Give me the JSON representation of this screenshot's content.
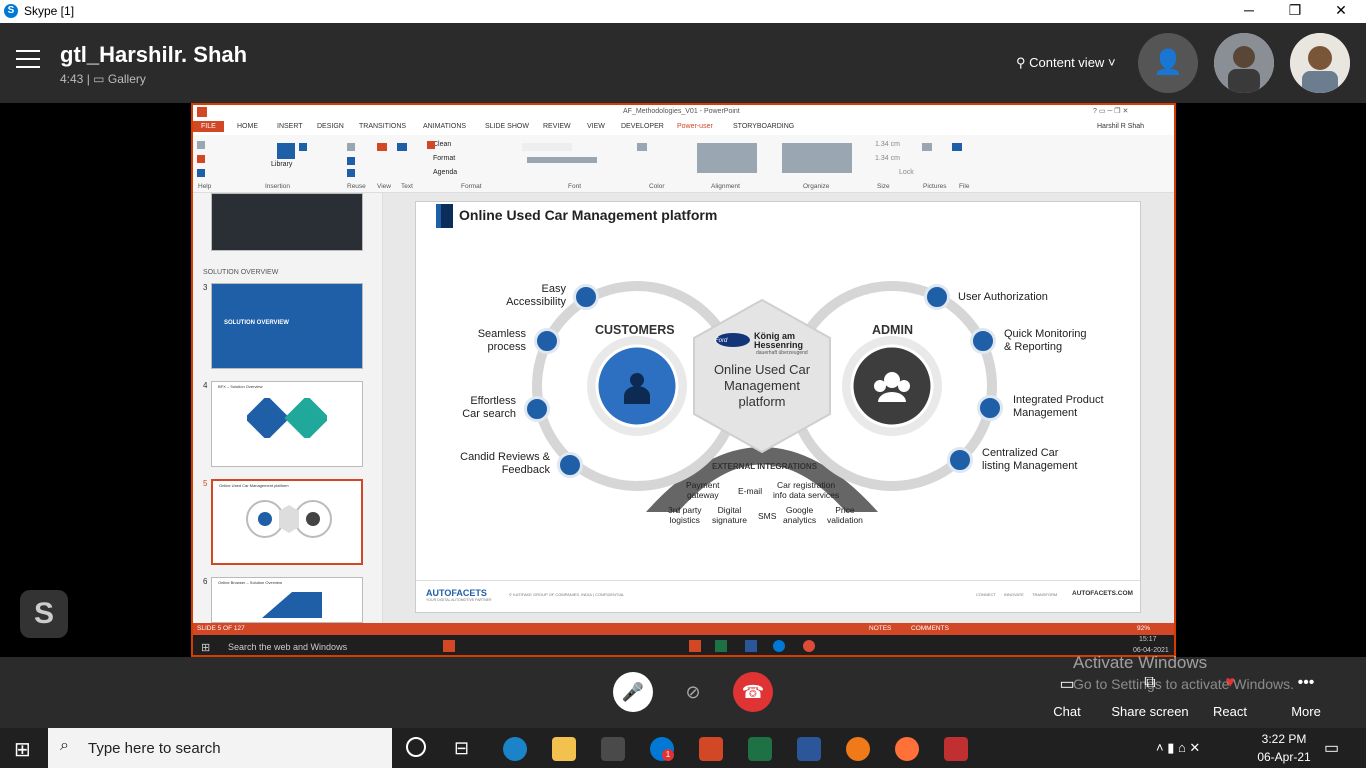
{
  "window": {
    "title": "Skype [1]"
  },
  "call": {
    "name": "gtl_Harshilr. Shah",
    "duration": "4:43",
    "separator": "|",
    "layout": "Gallery",
    "content_view": "Content view"
  },
  "ppt": {
    "doc_title": "AF_Methodologies_V01 - PowerPoint",
    "user": "Harshil R Shah",
    "tabs": [
      "FILE",
      "HOME",
      "INSERT",
      "DESIGN",
      "TRANSITIONS",
      "ANIMATIONS",
      "SLIDE SHOW",
      "REVIEW",
      "VIEW",
      "DEVELOPER",
      "Power-user",
      "STORYBOARDING"
    ],
    "ribbon_groups": [
      "Help",
      "Insertion",
      "Reuse",
      "View",
      "Text",
      "Format",
      "Font",
      "Color",
      "Alignment",
      "Organize",
      "Size",
      "Pictures",
      "File"
    ],
    "ribbon_items": {
      "clean": "Clean",
      "format": "Format",
      "agenda": "Agenda",
      "library": "Library",
      "size1": "1.34 cm",
      "size2": "1.34 cm",
      "lock": "Lock"
    },
    "section_label": "SOLUTION OVERVIEW",
    "thumbs": [
      {
        "num": "3",
        "title": "SOLUTION OVERVIEW"
      },
      {
        "num": "4",
        "title": "BFX – Solution Overview"
      },
      {
        "num": "5",
        "title": "Online Used Car Management platform"
      },
      {
        "num": "6",
        "title": "Online Browser – Solution Overview"
      }
    ],
    "status": {
      "slide": "SLIDE 5 OF 127",
      "notes": "NOTES",
      "comments": "COMMENTS",
      "zoom": "92%"
    }
  },
  "slide": {
    "title": "Online Used Car Management platform",
    "customers_label": "CUSTOMERS",
    "admin_label": "ADMIN",
    "center_brand1": "König am",
    "center_brand2": "Hessenring",
    "center_brand_sub": "dauerhaft überzeugend",
    "ford": "Ford",
    "center_text": "Online Used Car Management platform",
    "left_items": [
      {
        "l1": "Easy",
        "l2": "Accessibility"
      },
      {
        "l1": "Seamless",
        "l2": "process"
      },
      {
        "l1": "Effortless",
        "l2": "Car search"
      },
      {
        "l1": "Candid Reviews &",
        "l2": "Feedback"
      }
    ],
    "right_items": [
      {
        "l1": "User Authorization",
        "l2": ""
      },
      {
        "l1": "Quick Monitoring",
        "l2": "& Reporting"
      },
      {
        "l1": "Integrated Product",
        "l2": "Management"
      },
      {
        "l1": "Centralized Car",
        "l2": "listing Management"
      }
    ],
    "external_title": "EXTERNAL INTEGRATIONS",
    "ext_row1": [
      {
        "l1": "Payment",
        "l2": "gateway"
      },
      {
        "l1": "E-mail",
        "l2": ""
      },
      {
        "l1": "Car registration",
        "l2": "info data services"
      }
    ],
    "ext_row2": [
      {
        "l1": "3rd party",
        "l2": "logistics"
      },
      {
        "l1": "Digital",
        "l2": "signature"
      },
      {
        "l1": "SMS",
        "l2": ""
      },
      {
        "l1": "Google",
        "l2": "analytics"
      },
      {
        "l1": "Price",
        "l2": "validation"
      }
    ],
    "footer_logo": "AUTOFACETS",
    "footer_tag": "YOUR DIGITAL AUTOMOTIVE PARTNER",
    "footer_copy": "© KATIFAKE GROUP OF COMPANIES, INDIA | CONFIDENTIAL",
    "footer_links": [
      "CONNECT",
      "INNOVATE",
      "TRANSFORM"
    ],
    "footer_site": "AUTOFACETS.COM"
  },
  "inner_taskbar": {
    "search": "Search the web and Windows",
    "time": "15:17",
    "date": "06-04-2021"
  },
  "callbar": {
    "chat": "Chat",
    "share": "Share screen",
    "react": "React",
    "more": "More"
  },
  "watermark": {
    "line1": "Activate Windows",
    "line2": "Go to Settings to activate Windows."
  },
  "taskbar": {
    "search": "Type here to search",
    "time": "3:22 PM",
    "date": "06-Apr-21",
    "badge": "1"
  },
  "colors": {
    "accent": "#d83b01",
    "skype": "#0078d4",
    "hangup": "#e03434",
    "slide_blue": "#1f5fa8"
  }
}
